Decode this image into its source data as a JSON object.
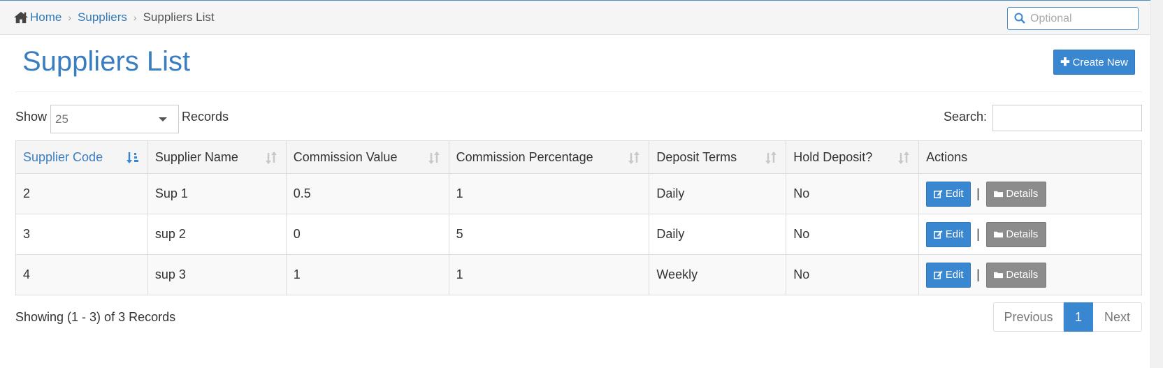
{
  "breadcrumb": {
    "home": "Home",
    "parent": "Suppliers",
    "current": "Suppliers List"
  },
  "top_search": {
    "placeholder": "Optional"
  },
  "page": {
    "title": "Suppliers List",
    "create_label": "Create New"
  },
  "length": {
    "show_label": "Show",
    "value": "25",
    "records_label": "Records"
  },
  "search": {
    "label": "Search:",
    "value": ""
  },
  "table": {
    "columns": [
      "Supplier Code",
      "Supplier Name",
      "Commission Value",
      "Commission Percentage",
      "Deposit Terms",
      "Hold Deposit?",
      "Actions"
    ],
    "rows": [
      [
        "2",
        "Sup 1",
        "0.5",
        "1",
        "Daily",
        "No"
      ],
      [
        "3",
        "sup 2",
        "0",
        "5",
        "Daily",
        "No"
      ],
      [
        "4",
        "sup 3",
        "1",
        "1",
        "Weekly",
        "No"
      ]
    ],
    "edit_label": "Edit",
    "details_label": "Details",
    "separator": "|"
  },
  "footer": {
    "info": "Showing (1 - 3) of 3 Records"
  },
  "pagination": {
    "previous": "Previous",
    "current": "1",
    "next": "Next"
  },
  "colors": {
    "accent": "#3a87d1",
    "title": "#3a7ec2",
    "details": "#8c8c8c"
  },
  "icons": [
    "home-icon",
    "search-icon",
    "plus-icon",
    "sort-asc-icon",
    "sort-icon",
    "edit-icon",
    "folder-icon"
  ]
}
